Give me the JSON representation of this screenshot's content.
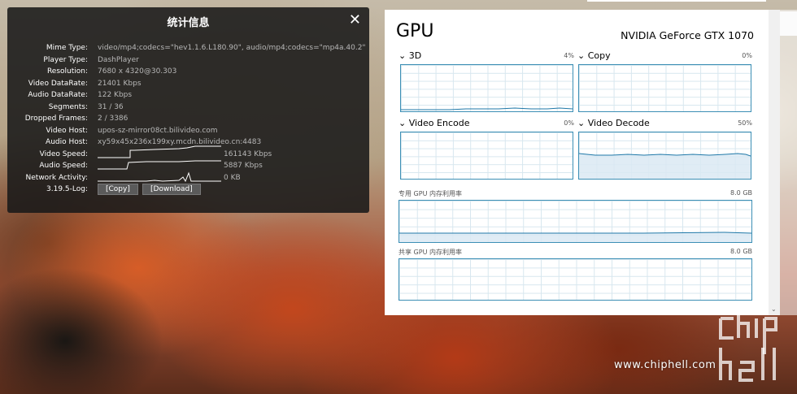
{
  "stats": {
    "title": "统计信息",
    "close": "✕",
    "rows": [
      {
        "key": "Mime Type:",
        "value": "video/mp4;codecs=\"hev1.1.6.L180.90\", audio/mp4;codecs=\"mp4a.40.2\""
      },
      {
        "key": "Player Type:",
        "value": "DashPlayer"
      },
      {
        "key": "Resolution:",
        "value": "7680 x 4320@30.303"
      },
      {
        "key": "Video DataRate:",
        "value": "21401 Kbps"
      },
      {
        "key": "Audio DataRate:",
        "value": "122 Kbps"
      },
      {
        "key": "Segments:",
        "value": "31 / 36"
      },
      {
        "key": "Dropped Frames:",
        "value": "2 / 3386"
      },
      {
        "key": "Video Host:",
        "value": "upos-sz-mirror08ct.bilivideo.com"
      },
      {
        "key": "Audio Host:",
        "value": "xy59x45x236x199xy.mcdn.bilivideo.cn:4483"
      },
      {
        "key": "Video Speed:",
        "value": "161143 Kbps"
      },
      {
        "key": "Audio Speed:",
        "value": "5887 Kbps"
      },
      {
        "key": "Network Activity:",
        "value": "0 KB"
      },
      {
        "key": "3.19.5-Log:",
        "copy": "[Copy]",
        "download": "[Download]"
      }
    ]
  },
  "gpu": {
    "header": "GPU",
    "model": "NVIDIA GeForce GTX 1070",
    "engines": [
      {
        "name": "3D",
        "percent": "4%",
        "chevron": "⌄"
      },
      {
        "name": "Copy",
        "percent": "0%",
        "chevron": "⌄"
      },
      {
        "name": "Video Encode",
        "percent": "0%",
        "chevron": "⌄"
      },
      {
        "name": "Video Decode",
        "percent": "50%",
        "chevron": "⌄"
      }
    ],
    "dedicated_memory": {
      "label": "专用 GPU 内存利用率",
      "max": "8.0 GB"
    },
    "shared_memory": {
      "label": "共享 GPU 内存利用率",
      "max": "8.0 GB"
    }
  },
  "watermark": "www.chiphell.com",
  "colors": {
    "graph_border": "#3c8fb5",
    "graph_line": "#1f78a8",
    "graph_fill": "#dbe9f3"
  }
}
